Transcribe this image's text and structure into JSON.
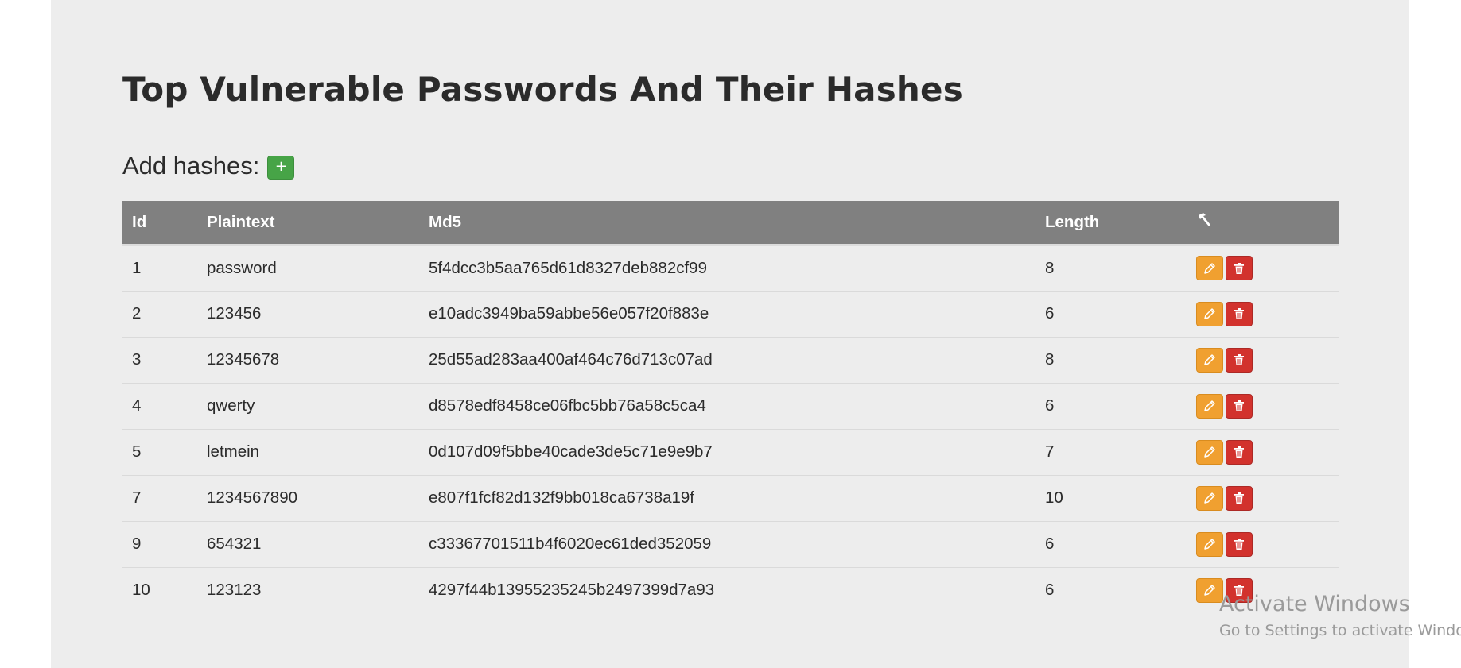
{
  "page": {
    "title": "Top Vulnerable Passwords And Their Hashes",
    "add_label": "Add hashes:",
    "add_icon": "+"
  },
  "table": {
    "headers": {
      "id": "Id",
      "plaintext": "Plaintext",
      "md5": "Md5",
      "length": "Length",
      "actions_icon": "hammer-icon"
    },
    "rows": [
      {
        "id": "1",
        "plaintext": "password",
        "md5": "5f4dcc3b5aa765d61d8327deb882cf99",
        "length": "8"
      },
      {
        "id": "2",
        "plaintext": "123456",
        "md5": "e10adc3949ba59abbe56e057f20f883e",
        "length": "6"
      },
      {
        "id": "3",
        "plaintext": "12345678",
        "md5": "25d55ad283aa400af464c76d713c07ad",
        "length": "8"
      },
      {
        "id": "4",
        "plaintext": "qwerty",
        "md5": "d8578edf8458ce06fbc5bb76a58c5ca4",
        "length": "6"
      },
      {
        "id": "5",
        "plaintext": "letmein",
        "md5": "0d107d09f5bbe40cade3de5c71e9e9b7",
        "length": "7"
      },
      {
        "id": "7",
        "plaintext": "1234567890",
        "md5": "e807f1fcf82d132f9bb018ca6738a19f",
        "length": "10"
      },
      {
        "id": "9",
        "plaintext": "654321",
        "md5": "c33367701511b4f6020ec61ded352059",
        "length": "6"
      },
      {
        "id": "10",
        "plaintext": "123123",
        "md5": "4297f44b13955235245b2497399d7a93",
        "length": "6"
      }
    ]
  },
  "watermark": {
    "title": "Activate Windows",
    "subtitle": "Go to Settings to activate Windows."
  },
  "colors": {
    "add_button": "#47a447",
    "edit_button": "#f0a030",
    "delete_button": "#d2322d",
    "header_bg": "#808080",
    "page_bg": "#ededed"
  }
}
